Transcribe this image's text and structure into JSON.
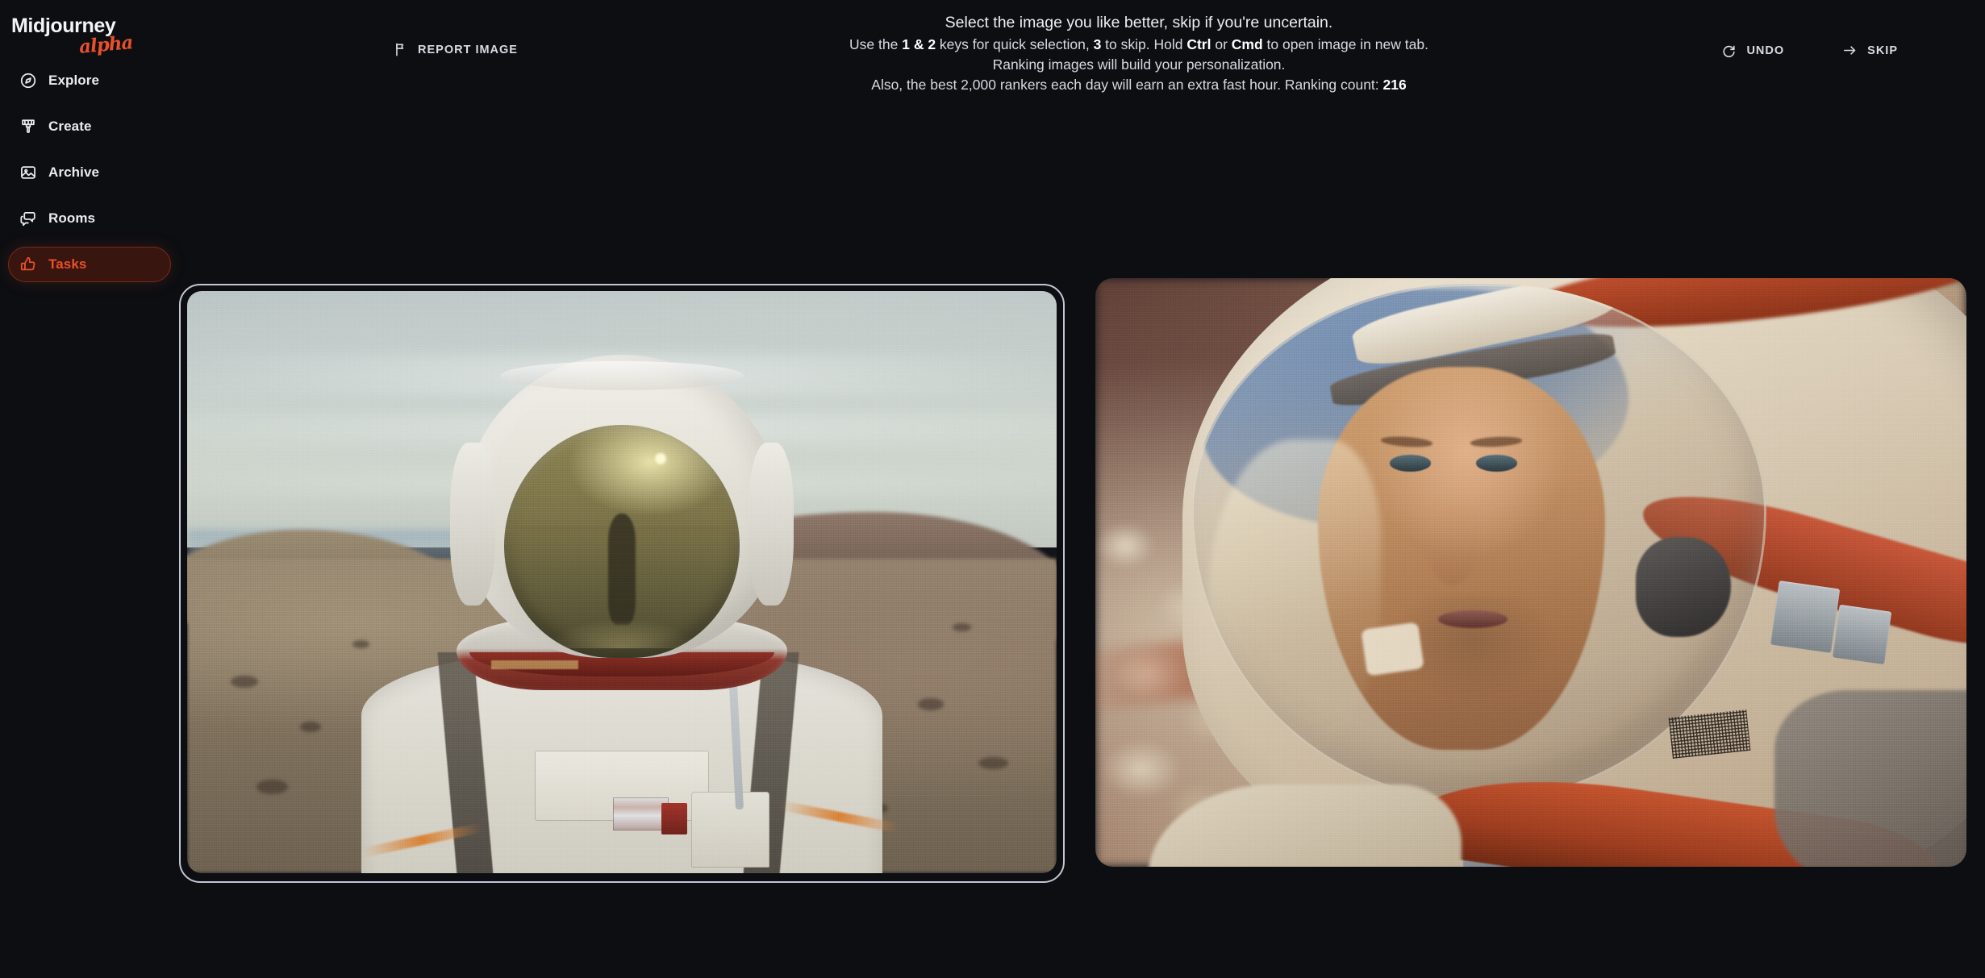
{
  "app": {
    "background_color": "#0c0e12",
    "accent_color": "#e8502a"
  },
  "sidebar": {
    "brand": {
      "name": "Midjourney",
      "tag": "alpha"
    },
    "items": [
      {
        "label": "Explore",
        "icon": "compass-icon",
        "active": false
      },
      {
        "label": "Create",
        "icon": "paintbrush-icon",
        "active": false
      },
      {
        "label": "Archive",
        "icon": "image-icon",
        "active": false
      },
      {
        "label": "Rooms",
        "icon": "chat-bubbles-icon",
        "active": false
      },
      {
        "label": "Tasks",
        "icon": "thumbs-up-icon",
        "active": true
      }
    ]
  },
  "topbar": {
    "report": {
      "label": "REPORT IMAGE",
      "icon": "flag-icon"
    },
    "undo": {
      "label": "UNDO",
      "icon": "rotate-ccw-icon"
    },
    "skip": {
      "label": "SKIP",
      "icon": "arrow-right-icon"
    }
  },
  "instructions": {
    "line1": "Select the image you like better, skip if you're uncertain.",
    "line2_a": "Use the ",
    "line2_b": "1 & 2",
    "line2_c": " keys for quick selection, ",
    "line2_d": "3",
    "line2_e": " to skip. Hold ",
    "line2_f": "Ctrl",
    "line2_g": " or ",
    "line2_h": "Cmd",
    "line2_i": " to open image in new tab.",
    "line3": "Ranking images will build your personalization.",
    "line4_a": "Also, the best 2,000 rankers each day will earn an extra fast hour. Ranking count: ",
    "line4_b": "216"
  },
  "ranking": {
    "count": "216",
    "rankers_per_day": "2,000"
  },
  "images": [
    {
      "position": "left",
      "selected": true,
      "alt": "Astronaut in white spacesuit with gold reflective visor standing in a rocky desert landscape under a pale blue-grey sky"
    },
    {
      "position": "right",
      "selected": false,
      "alt": "Close-up portrait of a weathered astronaut's face seen through a clear helmet visor, warm orange and tan tones, rocky terrain behind"
    }
  ]
}
